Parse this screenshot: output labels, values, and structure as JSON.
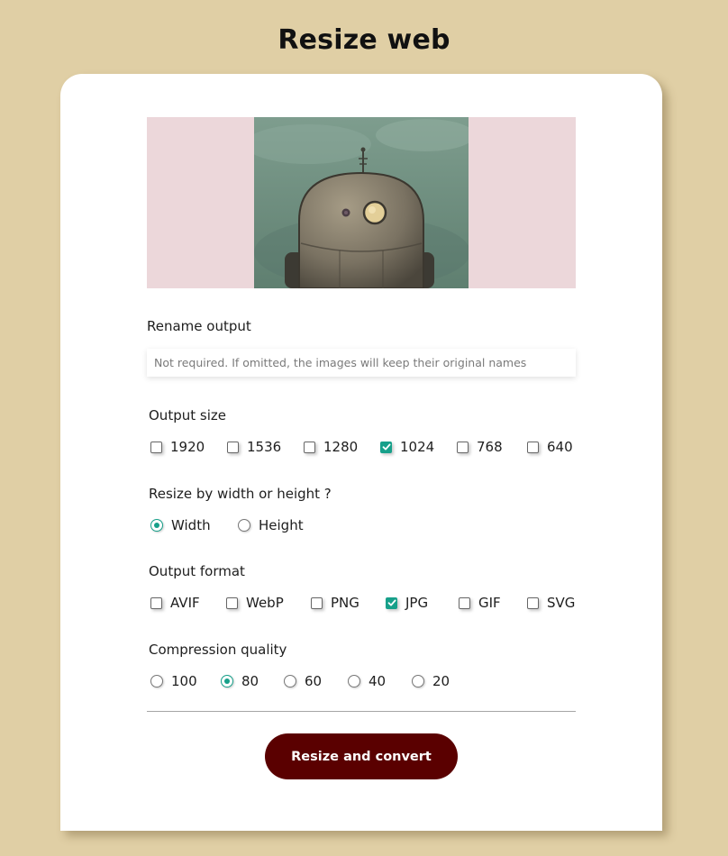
{
  "page": {
    "title": "Resize web"
  },
  "rename": {
    "label": "Rename output",
    "value": "",
    "placeholder": "Not required. If omitted, the images will keep their original names"
  },
  "output_size": {
    "label": "Output size",
    "options": [
      {
        "label": "1920",
        "checked": false
      },
      {
        "label": "1536",
        "checked": false
      },
      {
        "label": "1280",
        "checked": false
      },
      {
        "label": "1024",
        "checked": true
      },
      {
        "label": "768",
        "checked": false
      },
      {
        "label": "640",
        "checked": false
      }
    ]
  },
  "resize_by": {
    "label": "Resize by width or height ?",
    "options": [
      {
        "label": "Width",
        "checked": true
      },
      {
        "label": "Height",
        "checked": false
      }
    ]
  },
  "output_format": {
    "label": "Output format",
    "options": [
      {
        "label": "AVIF",
        "checked": false
      },
      {
        "label": "WebP",
        "checked": false
      },
      {
        "label": "PNG",
        "checked": false
      },
      {
        "label": "JPG",
        "checked": true
      },
      {
        "label": "GIF",
        "checked": false
      },
      {
        "label": "SVG",
        "checked": false
      }
    ]
  },
  "quality": {
    "label": "Compression quality",
    "options": [
      {
        "label": "100",
        "checked": false
      },
      {
        "label": "80",
        "checked": true
      },
      {
        "label": "60",
        "checked": false
      },
      {
        "label": "40",
        "checked": false
      },
      {
        "label": "20",
        "checked": false
      }
    ]
  },
  "submit": {
    "label": "Resize and convert"
  },
  "colors": {
    "background": "#e0cfa5",
    "card": "#ffffff",
    "preview_background": "#ecd7da",
    "accent": "#17a08a",
    "button": "#5a0000"
  },
  "icons": {
    "check": "check-icon"
  }
}
